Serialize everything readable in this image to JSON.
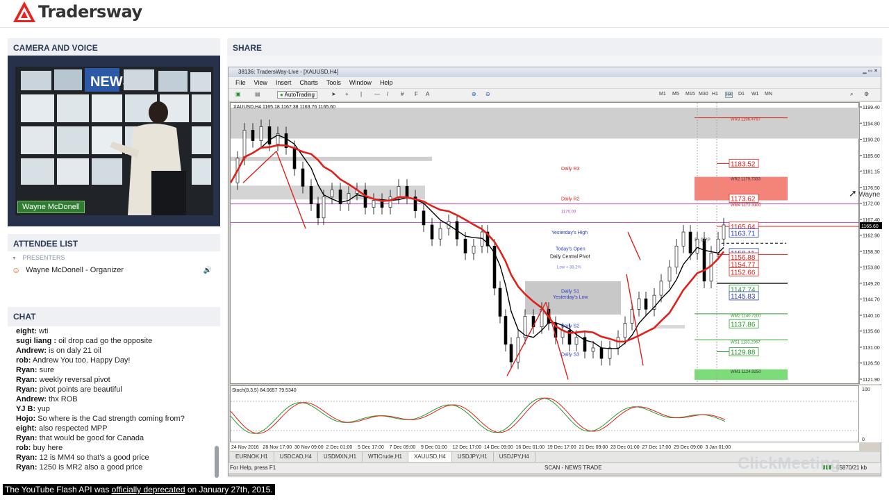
{
  "brand": {
    "name": "Tradersway"
  },
  "panels": {
    "camera": "CAMERA AND VOICE",
    "share": "SHARE",
    "attendees": "ATTENDEE LIST",
    "chat": "CHAT"
  },
  "camera": {
    "presenter_name": "Wayne McDonell",
    "news_sign": "NEWS"
  },
  "attendees": {
    "group_label": "PRESENTERS",
    "items": [
      {
        "name": "Wayne McDonell - Organizer"
      }
    ]
  },
  "chat": {
    "messages": [
      {
        "user": "eight:",
        "text": " wti"
      },
      {
        "user": "sugi liang :",
        "text": " oil drop cad go the opposite"
      },
      {
        "user": "Andrew:",
        "text": " is on daly 21 oil"
      },
      {
        "user": "rob:",
        "text": " Andrew You too. Happy Day!"
      },
      {
        "user": "Ryan:",
        "text": " sure"
      },
      {
        "user": "Ryan:",
        "text": " weekly reversal pivot"
      },
      {
        "user": "Ryan:",
        "text": " pivot points are beautiful"
      },
      {
        "user": "Andrew:",
        "text": " thx ROB"
      },
      {
        "user": "YJ B:",
        "text": " yup"
      },
      {
        "user": "Hojo:",
        "text": " So where is the Cad strength coming from?"
      },
      {
        "user": "eight:",
        "text": " also respected MPP"
      },
      {
        "user": "Ryan:",
        "text": " that would be good for Canada"
      },
      {
        "user": "rob:",
        "text": " buy here"
      },
      {
        "user": "Ryan:",
        "text": " 12 is MM4 so that's a good price"
      },
      {
        "user": "Ryan:",
        "text": " 1250 is MR2 also a good price"
      }
    ]
  },
  "mt4": {
    "title": "38136: TradersWay-Live - [XAUUSD,H4]",
    "menu": [
      "File",
      "View",
      "Insert",
      "Charts",
      "Tools",
      "Window",
      "Help"
    ],
    "autotrading": "AutoTrading",
    "timeframes": [
      "M1",
      "M5",
      "M15",
      "M30",
      "H1",
      "H4",
      "D1",
      "W1",
      "MN"
    ],
    "symbol_info": "XAUUSD,H4  1165.18 1167.38 1163.76 1165.60",
    "stoch_info": "Stoch(8,3,5) 84.0657 79.5340",
    "price_ticks": [
      "1199.40",
      "1194.80",
      "1190.20",
      "1185.60",
      "1181.15",
      "1176.50",
      "1172.00",
      "1167.40",
      "1162.90",
      "1158.30",
      "1153.80",
      "1149.20",
      "1144.70",
      "1140.10",
      "1135.60",
      "1131.00",
      "1126.50",
      "1121.90"
    ],
    "current_price": "1165.60",
    "stoch_ticks": [
      "100",
      "0"
    ],
    "time_labels": [
      "24 Nov 2016",
      "28 Nov 17:00",
      "30 Nov 09:00",
      "2 Dec 01:00",
      "5 Dec 17:00",
      "7 Dec 09:00",
      "9 Dec 01:00",
      "12 Dec 17:00",
      "14 Dec 09:00",
      "16 Dec 01:00",
      "19 Dec 17:00",
      "21 Dec 09:00",
      "23 Dec 01:00",
      "27 Dec 17:00",
      "29 Dec 09:00",
      "3 Jan 01:00"
    ],
    "level_boxes": [
      "1183.52",
      "1173.62",
      "1165.64",
      "1163.71",
      "1158.11",
      "1156.88",
      "1154.77",
      "1152.66",
      "1147.74",
      "1145.83",
      "1137.86",
      "1129.88"
    ],
    "pivot_labels": {
      "wr3": "WR3 1196.4767",
      "wr2": "WR2 1179.7333",
      "wm4": "WM4 1172.3100",
      "ws1": "WS1 1133.2967",
      "wm2": "WM2 1140.7200",
      "wm1": "WM1 1124.9250",
      "daily_r3": "Daily R3",
      "daily_r2": "Daily R2",
      "level_1170": "1170.00",
      "yesterdays_high": "Yesterday's High",
      "todays_open": "Today's Open",
      "daily_central": "Daily Central Pivot",
      "daily_s1": "Daily S1",
      "yesterdays_low": "Yesterday's Low",
      "daily_s2": "Daily S2",
      "daily_s3": "Daily S3",
      "low_382": "Low + 38.2%",
      "p_cpp": "P_CPP"
    },
    "tabs": [
      "EURNOK,H1",
      "USDCAD,H4",
      "USDMXN,H1",
      "WTICrude,H1",
      "XAUUSD,H4",
      "USDJPY,H1",
      "USDJPY,H4"
    ],
    "active_tab": "XAUUSD,H4",
    "status_left": "For Help, press F1",
    "status_mid": "SCAN - NEWS TRADE",
    "status_right": "55870/21 kb"
  },
  "cursor_label": "Wayne",
  "watermark": "ClickMeeting",
  "youtube_notice": {
    "before": "The YouTube Flash API was ",
    "link": "officially deprecated",
    "after": " on January 27th, 2015."
  },
  "colors": {
    "ema_red": "#e0201a",
    "line_black": "#000000",
    "zone_gray": "#c8c8c8",
    "wr2_zone": "#f4847a",
    "wm1_zone": "#7ddc7a",
    "chat_header": "#2b3b57"
  }
}
